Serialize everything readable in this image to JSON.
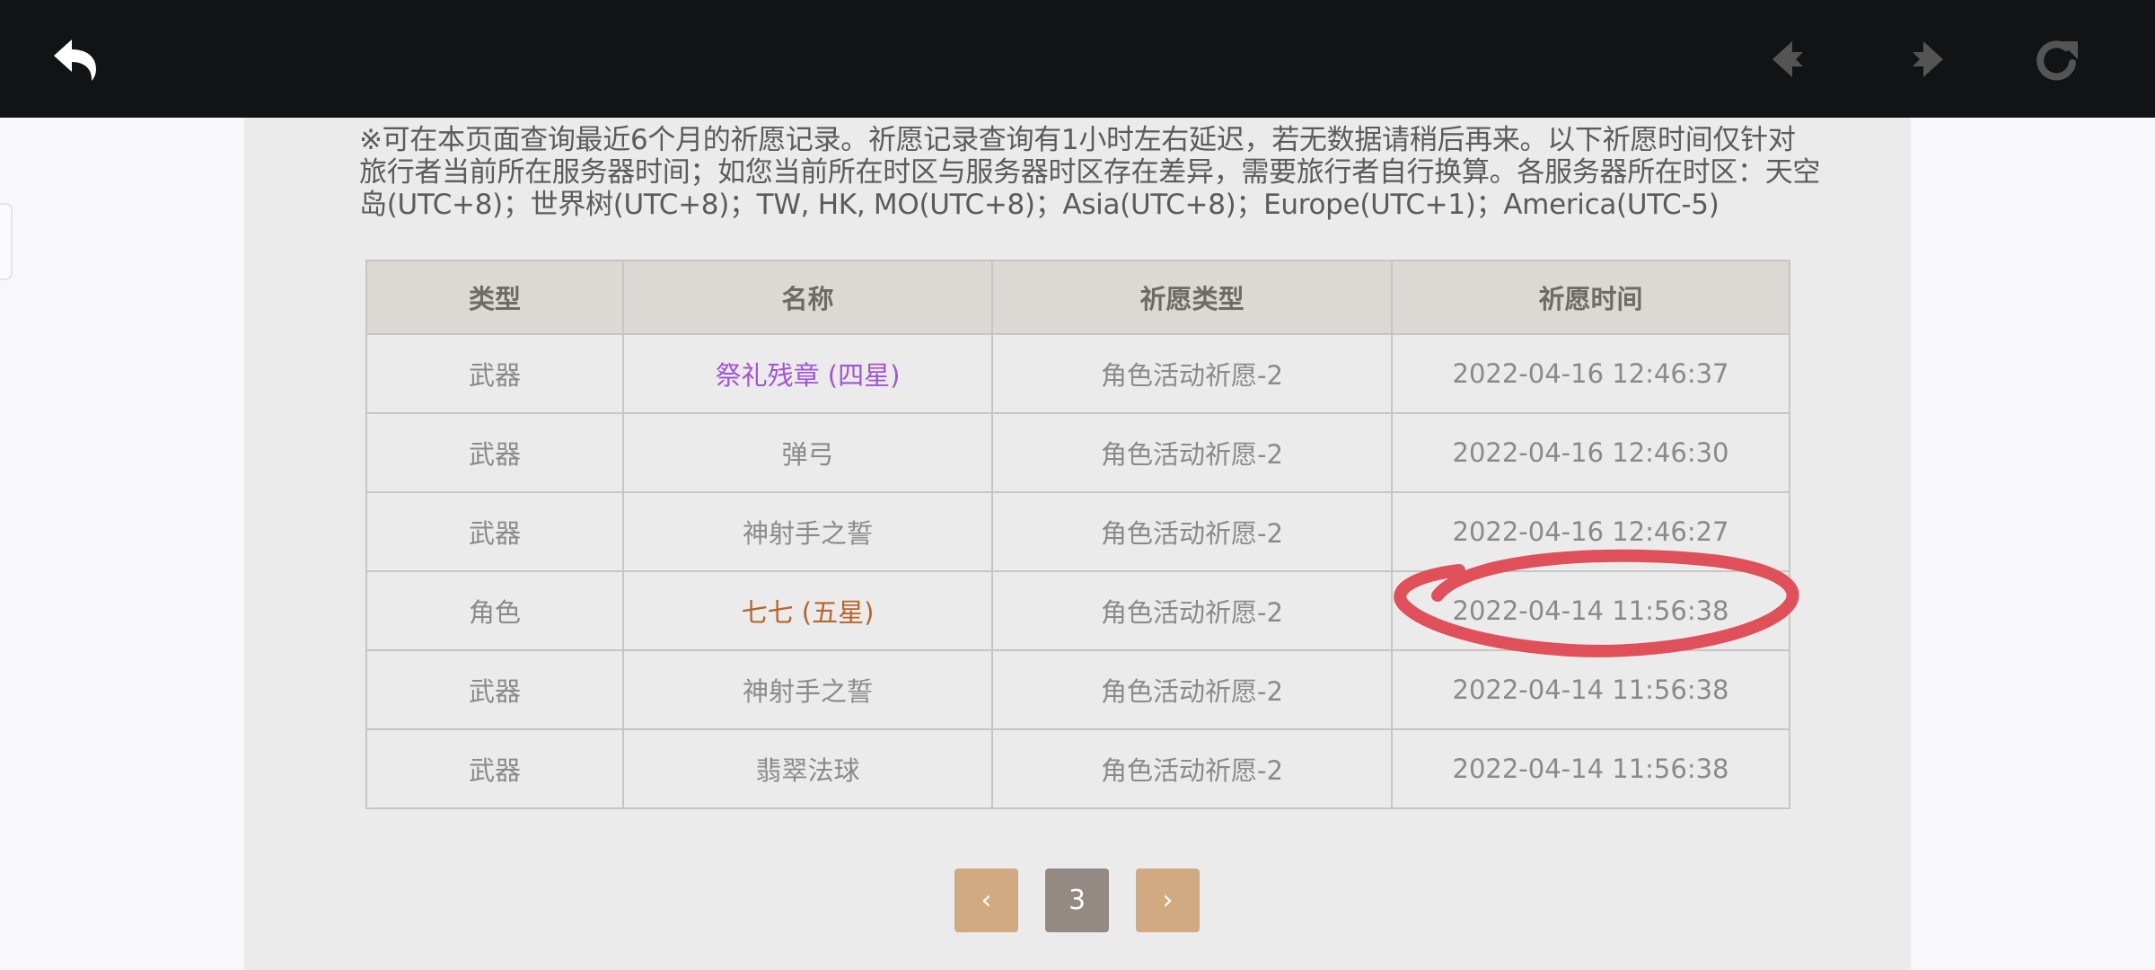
{
  "toolbar": {
    "back_icon": "back-arrow-icon",
    "prev_icon": "nav-prev-icon",
    "next_icon": "nav-next-icon",
    "refresh_icon": "refresh-icon"
  },
  "notice": "※可在本页面查询最近6个月的祈愿记录。祈愿记录查询有1小时左右延迟，若无数据请稍后再来。以下祈愿时间仅针对旅行者当前所在服务器时间；如您当前所在时区与服务器时区存在差异，需要旅行者自行换算。各服务器所在时区：天空岛(UTC+8)；世界树(UTC+8)；TW, HK, MO(UTC+8)；Asia(UTC+8)；Europe(UTC+1)；America(UTC-5)",
  "table": {
    "headers": [
      "类型",
      "名称",
      "祈愿类型",
      "祈愿时间"
    ],
    "rows": [
      {
        "type": "武器",
        "name": "祭礼残章 (四星)",
        "wish": "角色活动祈愿-2",
        "time": "2022-04-16 12:46:37"
      },
      {
        "type": "武器",
        "name": "弹弓",
        "wish": "角色活动祈愿-2",
        "time": "2022-04-16 12:46:30"
      },
      {
        "type": "武器",
        "name": "神射手之誓",
        "wish": "角色活动祈愿-2",
        "time": "2022-04-16 12:46:27"
      },
      {
        "type": "角色",
        "name": "七七 (五星)",
        "wish": "角色活动祈愿-2",
        "time": "2022-04-14 11:56:38"
      },
      {
        "type": "武器",
        "name": "神射手之誓",
        "wish": "角色活动祈愿-2",
        "time": "2022-04-14 11:56:38"
      },
      {
        "type": "武器",
        "name": "翡翠法球",
        "wish": "角色活动祈愿-2",
        "time": "2022-04-14 11:56:38"
      }
    ]
  },
  "pagination": {
    "prev": "‹",
    "current": "3",
    "next": "›"
  },
  "colors": {
    "four_star": "#a155d4",
    "five_star": "#b8652b",
    "annotation": "#e0505a",
    "pager_button": "#d1aa81",
    "pager_current": "#948a83"
  }
}
